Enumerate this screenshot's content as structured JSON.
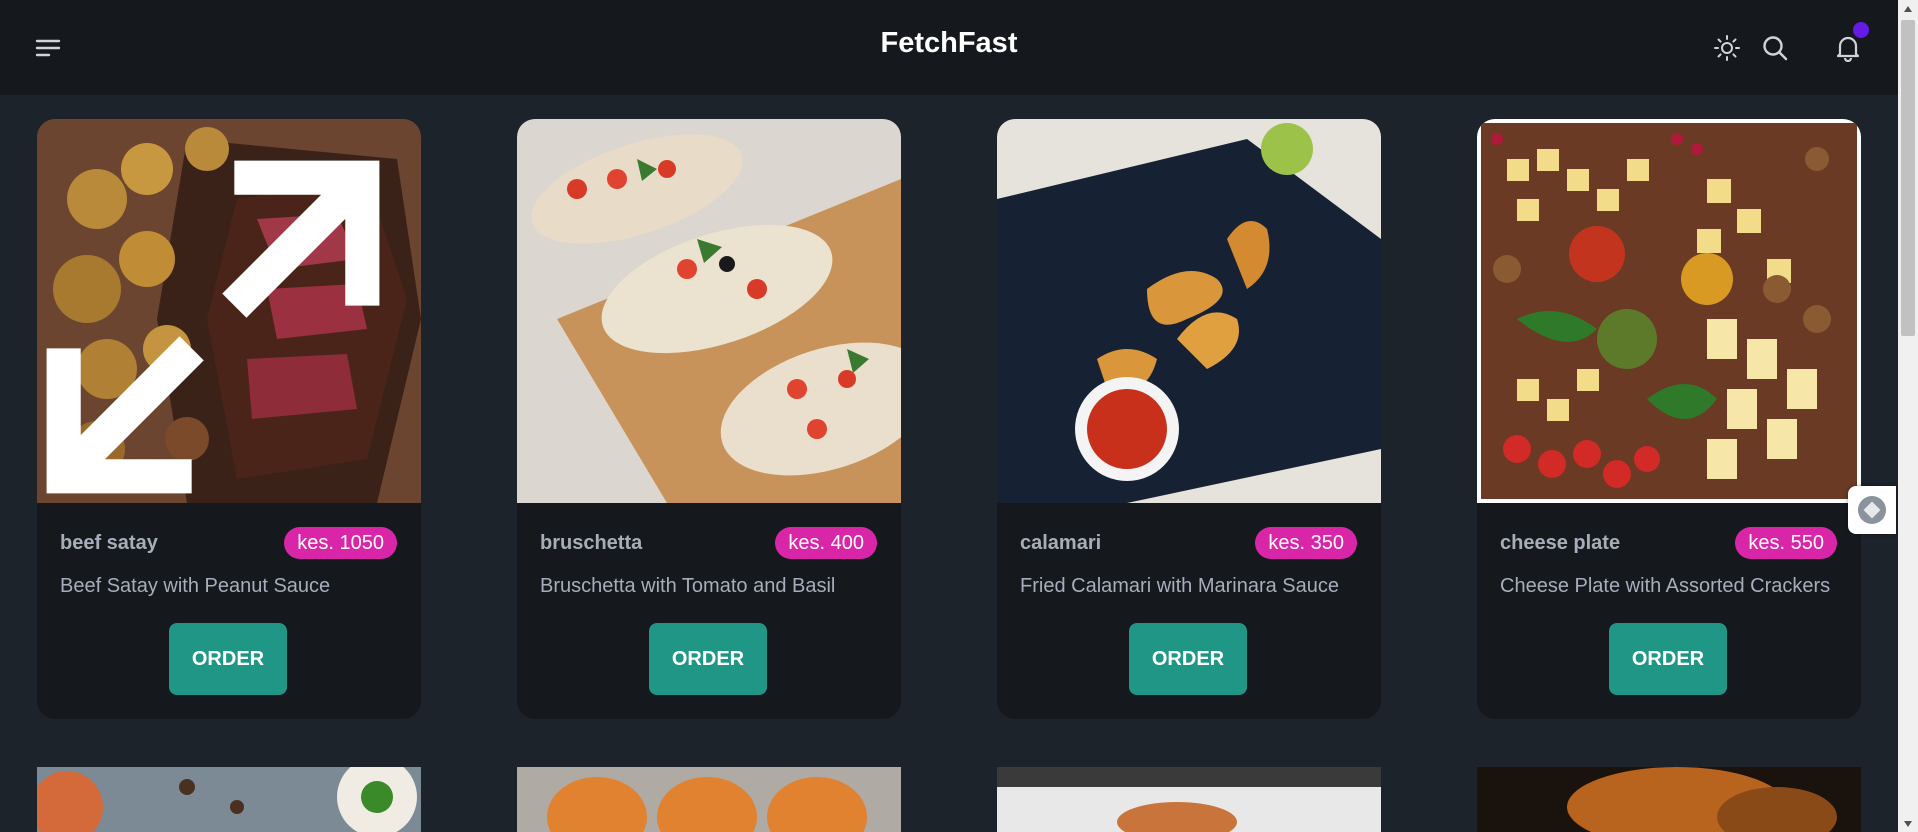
{
  "app": {
    "title": "FetchFast"
  },
  "header": {
    "menu_icon": "menu-icon",
    "theme_icon": "sun-icon",
    "search_icon": "search-icon",
    "notification_icon": "bell-icon"
  },
  "colors": {
    "background": "#1d232a",
    "navbar": "#15191e",
    "card": "#15191e",
    "price_badge": "#d926a9",
    "order_button": "#1f9686",
    "notification_dot": "#661ae6"
  },
  "products": [
    {
      "name": "beef satay",
      "price": "kes. 1050",
      "description": "Beef Satay with Peanut Sauce",
      "button": "ORDER"
    },
    {
      "name": "bruschetta",
      "price": "kes. 400",
      "description": "Bruschetta with Tomato and Basil",
      "button": "ORDER"
    },
    {
      "name": "calamari",
      "price": "kes. 350",
      "description": "Fried Calamari with Marinara Sauce",
      "button": "ORDER"
    },
    {
      "name": "cheese plate",
      "price": "kes. 550",
      "description": "Cheese Plate with Assorted Crackers",
      "button": "ORDER"
    }
  ]
}
